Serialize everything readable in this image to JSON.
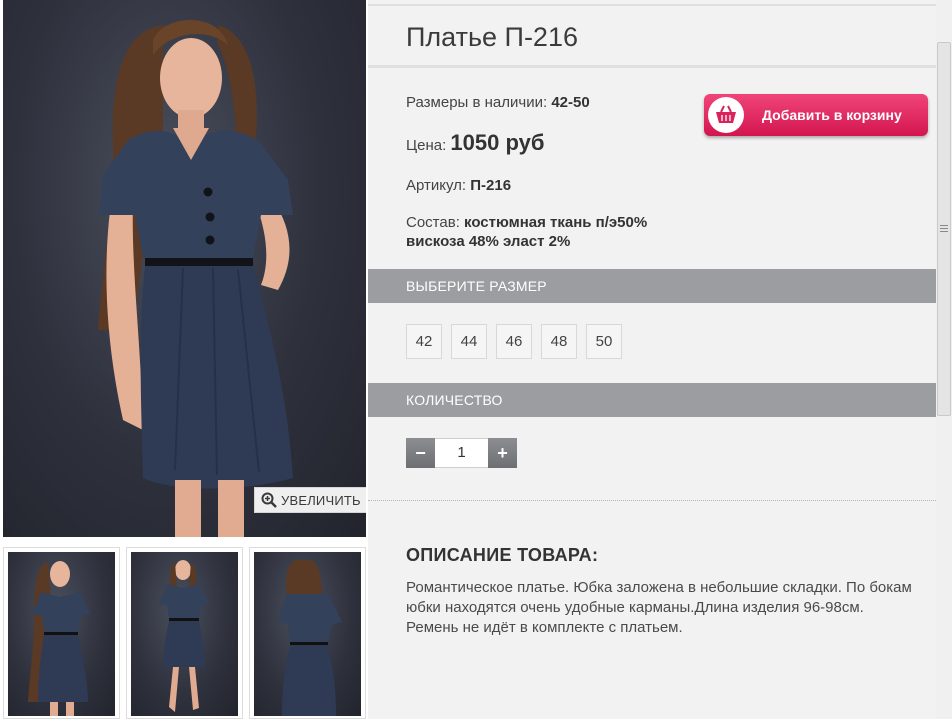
{
  "product": {
    "title": "Платье П-216",
    "sizes_available_label": "Размеры в наличии:",
    "sizes_available_value": "42-50",
    "price_label": "Цена:",
    "price_value": "1050 руб",
    "article_label": "Артикул:",
    "article_value": "П-216",
    "composition_label": "Состав:",
    "composition_line1": "костюмная ткань п/э50%",
    "composition_line2": "вискоза 48% эласт 2%"
  },
  "cart_button": {
    "label": "Добавить в корзину",
    "icon": "basket-icon"
  },
  "zoom_button": {
    "label": "УВЕЛИЧИТЬ",
    "icon": "magnifier-plus-icon"
  },
  "size_section": {
    "header": "ВЫБЕРИТЕ РАЗМЕР",
    "options": [
      "42",
      "44",
      "46",
      "48",
      "50"
    ]
  },
  "quantity_section": {
    "header": "КОЛИЧЕСТВО",
    "minus": "−",
    "value": "1",
    "plus": "+"
  },
  "description": {
    "title": "ОПИСАНИЕ ТОВАРА:",
    "text": "Романтическое платье. Юбка заложена в небольшие складки. По бокам юбки находятся очень удобные карманы.Длина изделия 96-98см. Ремень не идёт в комплекте с платьем."
  },
  "colors": {
    "panel_bg": "#f2f2f2",
    "section_bar": "#9b9da0",
    "cart_button": "#dd1f58",
    "dress": "#33405a",
    "photo_bg": "#2e313c"
  }
}
